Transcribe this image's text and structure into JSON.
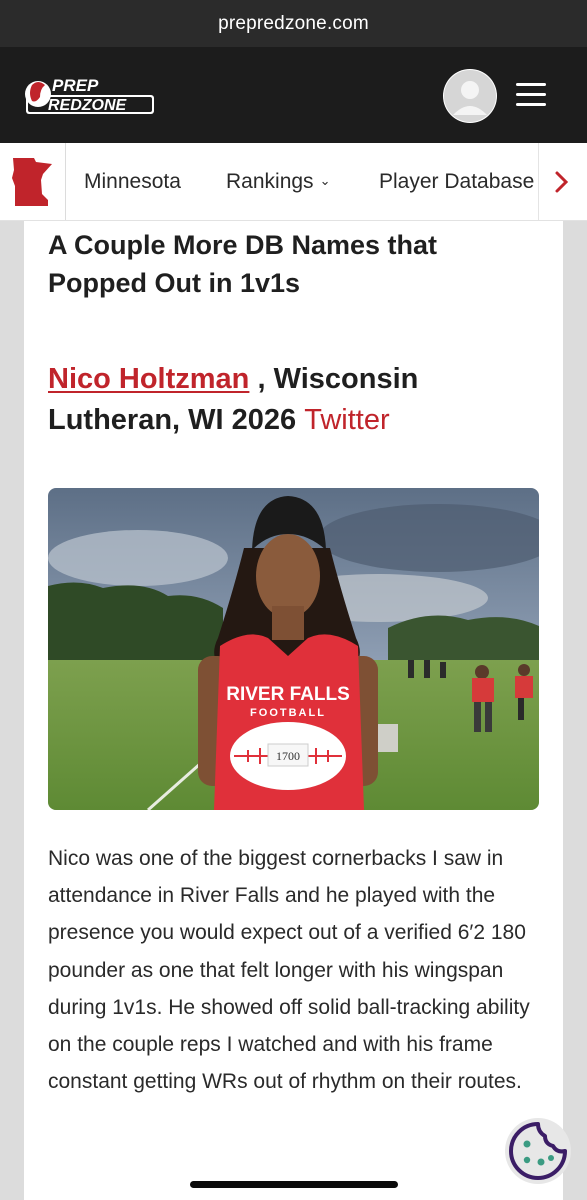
{
  "browser": {
    "url": "prepredzone.com"
  },
  "header": {
    "logo_line1": "PREP",
    "logo_line2": "REDZONE"
  },
  "nav": {
    "items": [
      {
        "label": "Minnesota",
        "has_dropdown": false
      },
      {
        "label": "Rankings",
        "has_dropdown": true
      },
      {
        "label": "Player Database",
        "has_dropdown": false
      }
    ]
  },
  "article": {
    "title": "A Couple More DB Names that Popped Out in 1v1s",
    "player_name": "Nico Holtzman",
    "player_info": ", Wisconsin Lutheran, WI 2026",
    "twitter_label": "Twitter",
    "photo": {
      "jersey_line1": "RIVER FALLS",
      "jersey_line2": "FOOTBALL",
      "number_tag": "1700"
    },
    "body": "Nico was one of the biggest cornerbacks I saw in attendance in River Falls and he played with the presence you would expect out of a verified 6′2 180 pounder as one that felt longer with his wingspan during 1v1s. He showed off solid ball-tracking ability on the couple reps I watched and with his frame constant getting WRs out of rhythm on their routes."
  },
  "colors": {
    "brand_red": "#c0242b",
    "header_bg": "#1c1c1c",
    "cookie_purple": "#3b1d66"
  }
}
